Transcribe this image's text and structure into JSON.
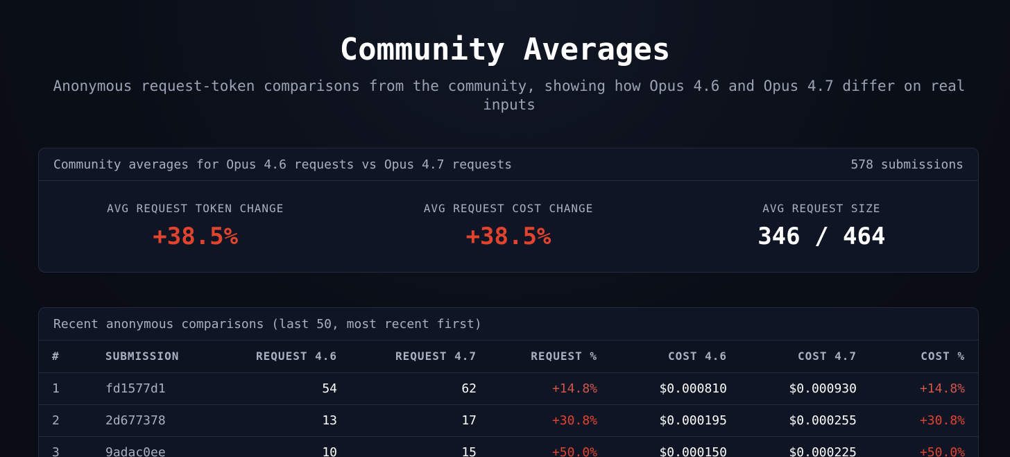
{
  "header": {
    "title": "Community Averages",
    "subtitle": "Anonymous request-token comparisons from the community, showing how Opus 4.6 and Opus 4.7 differ on real inputs"
  },
  "summary": {
    "label": "Community averages for Opus 4.6 requests vs Opus 4.7 requests",
    "count": "578 submissions",
    "stats": [
      {
        "label": "AVG REQUEST TOKEN CHANGE",
        "value": "+38.5%"
      },
      {
        "label": "AVG REQUEST COST CHANGE",
        "value": "+38.5%"
      },
      {
        "label": "AVG REQUEST SIZE",
        "value": "346 / 464"
      }
    ]
  },
  "recent": {
    "label": "Recent anonymous comparisons (last 50, most recent first)",
    "columns": [
      "#",
      "SUBMISSION",
      "REQUEST 4.6",
      "REQUEST 4.7",
      "REQUEST %",
      "COST 4.6",
      "COST 4.7",
      "COST %"
    ],
    "rows": [
      [
        "1",
        "fd1577d1",
        "54",
        "62",
        "+14.8%",
        "$0.000810",
        "$0.000930",
        "+14.8%"
      ],
      [
        "2",
        "2d677378",
        "13",
        "17",
        "+30.8%",
        "$0.000195",
        "$0.000255",
        "+30.8%"
      ],
      [
        "3",
        "9adac0ee",
        "10",
        "15",
        "+50.0%",
        "$0.000150",
        "$0.000225",
        "+50.0%"
      ]
    ]
  },
  "colors": {
    "background": "#0a0e17",
    "card": "#0f1524",
    "border": "#232b3d",
    "increase": "#e0442f",
    "muted_text": "#a9b0bf"
  }
}
